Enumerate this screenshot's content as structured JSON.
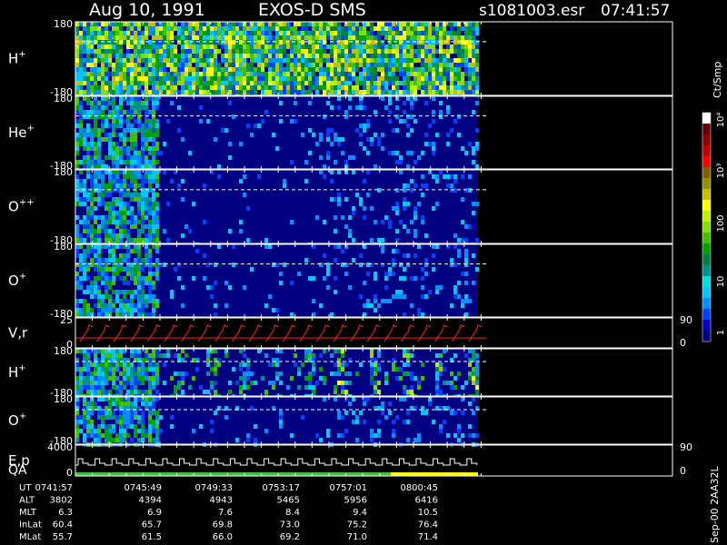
{
  "header": {
    "date": "Aug 10, 1991",
    "instrument": "EXOS-D SMS",
    "file": "s1081003.esr",
    "time": "07:41:57"
  },
  "colorbar": {
    "unit_label": "Ct/Smp",
    "tick_labels": [
      "1",
      "10",
      "100",
      "10³",
      "10⁴"
    ],
    "colors": [
      "#000080",
      "#0000c8",
      "#0040ff",
      "#0090ff",
      "#00c8ff",
      "#00e0e0",
      "#009090",
      "#008040",
      "#00a000",
      "#40c000",
      "#80e000",
      "#c0f000",
      "#ffff00",
      "#c0c000",
      "#909000",
      "#806000",
      "#ff0000",
      "#c00000",
      "#900000",
      "#600000",
      "#ffffff"
    ]
  },
  "side_text": "Sep-00 2AA32L",
  "chart_data": {
    "type": "heatmap",
    "panels": [
      {
        "id": "H+ angle",
        "label": "H",
        "sup": "+",
        "ytop": "180",
        "ybot": "-180",
        "background": "#000080",
        "activity": "high"
      },
      {
        "id": "He+ angle",
        "label": "He",
        "sup": "+",
        "ytop": "180",
        "ybot": "-180",
        "background": "#000080",
        "activity": "sparse"
      },
      {
        "id": "O++ angle",
        "label": "O",
        "sup": "++",
        "ytop": "180",
        "ybot": "-180",
        "background": "#000080",
        "activity": "sparse"
      },
      {
        "id": "O+ angle",
        "label": "O",
        "sup": "+",
        "ytop": "180",
        "ybot": "-180",
        "background": "#000080",
        "activity": "sparse"
      },
      {
        "id": "V,r",
        "label": "V,r",
        "ytop": "25",
        "ybot": "0",
        "right_top": "90",
        "right_bot": "0",
        "line_color": "#ff2020"
      },
      {
        "id": "H+ energy",
        "label": "H",
        "sup": "+",
        "ytop": "180",
        "ybot": "-180",
        "background": "#000080",
        "activity": "stripes"
      },
      {
        "id": "O+ energy",
        "label": "O",
        "sup": "+",
        "ytop": "180",
        "ybot": "-180",
        "background": "#000080",
        "activity": "sparse"
      },
      {
        "id": "E,p QA",
        "label": "E,p",
        "label2": "QA",
        "ytop": "4000",
        "ybot": "0",
        "right_top": "90",
        "right_bot": "0",
        "qa_colors": [
          "#40c040",
          "#ffff00"
        ]
      }
    ],
    "xaxis": {
      "rows": [
        {
          "name": "UT",
          "values": [
            "0741:57",
            "0745:49",
            "0749:33",
            "0753:17",
            "0757:01",
            "0800:45"
          ]
        },
        {
          "name": "ALT",
          "values": [
            "3802",
            "4394",
            "4943",
            "5465",
            "5956",
            "6416"
          ]
        },
        {
          "name": "MLT",
          "values": [
            "6.3",
            "6.9",
            "7.6",
            "8.4",
            "9.4",
            "10.5"
          ]
        },
        {
          "name": "InLat",
          "values": [
            "60.4",
            "65.7",
            "69.8",
            "73.0",
            "75.2",
            "76.4"
          ]
        },
        {
          "name": "MLat",
          "values": [
            "55.7",
            "61.5",
            "66.0",
            "69.2",
            "71.0",
            "71.4"
          ]
        }
      ]
    }
  }
}
